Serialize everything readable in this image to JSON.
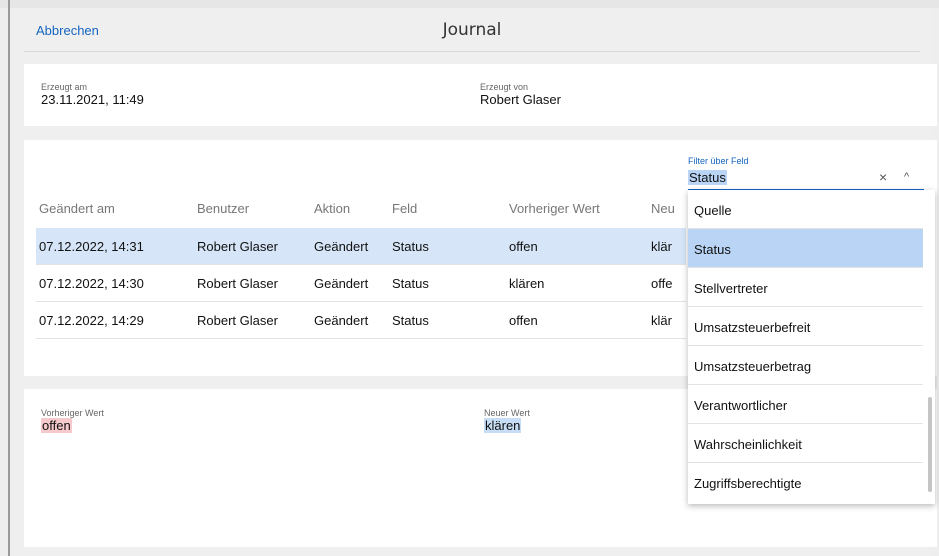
{
  "header": {
    "cancel_label": "Abbrechen",
    "title": "Journal"
  },
  "meta": {
    "created_at_label": "Erzeugt am",
    "created_at_value": "23.11.2021, 11:49",
    "created_by_label": "Erzeugt von",
    "created_by_value": "Robert Glaser"
  },
  "filter": {
    "label": "Filter über Feld",
    "value": "Status",
    "clear_icon": "×",
    "collapse_icon": "^"
  },
  "table": {
    "columns": [
      "Geändert am",
      "Benutzer",
      "Aktion",
      "Feld",
      "Vorheriger Wert",
      "Neu"
    ],
    "rows": [
      [
        "07.12.2022, 14:31",
        "Robert Glaser",
        "Geändert",
        "Status",
        "offen",
        "klär"
      ],
      [
        "07.12.2022, 14:30",
        "Robert Glaser",
        "Geändert",
        "Status",
        "klären",
        "offe"
      ],
      [
        "07.12.2022, 14:29",
        "Robert Glaser",
        "Geändert",
        "Status",
        "offen",
        "klär"
      ]
    ]
  },
  "dropdown": {
    "options": [
      "Quelle",
      "Status",
      "Stellvertreter",
      "Umsatzsteuerbefreit",
      "Umsatzsteuerbetrag",
      "Verantwortlicher",
      "Wahrscheinlichkeit",
      "Zugriffsberechtigte"
    ],
    "selected": "Status"
  },
  "detail": {
    "previous_label": "Vorheriger Wert",
    "previous_value": "offen",
    "new_label": "Neuer Wert",
    "new_value": "klären"
  },
  "colors": {
    "accent": "#1565c0",
    "selected_row": "#d6e6f8",
    "previous_highlight": "#f6c9cd",
    "new_highlight": "#c7ddf5"
  }
}
